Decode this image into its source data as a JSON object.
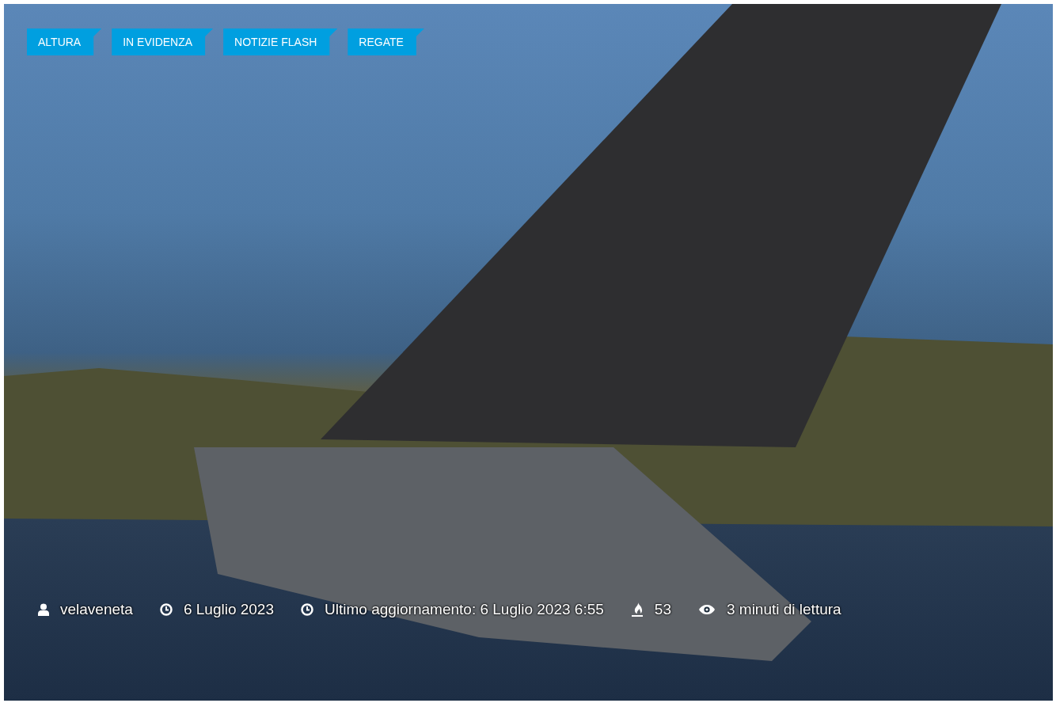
{
  "tags": [
    {
      "label": "ALTURA"
    },
    {
      "label": "IN EVIDENZA"
    },
    {
      "label": "NOTIZIE FLASH"
    },
    {
      "label": "REGATE"
    }
  ],
  "meta": [
    {
      "kind": "author",
      "text": "velaveneta"
    },
    {
      "kind": "date",
      "text": "6 Luglio 2023"
    },
    {
      "kind": "date",
      "text": "Ultimo aggiornamento: 6 Luglio 2023 6:55"
    },
    {
      "kind": "views",
      "text": "53"
    },
    {
      "kind": "reading",
      "text": "3 minuti di lettura"
    }
  ]
}
